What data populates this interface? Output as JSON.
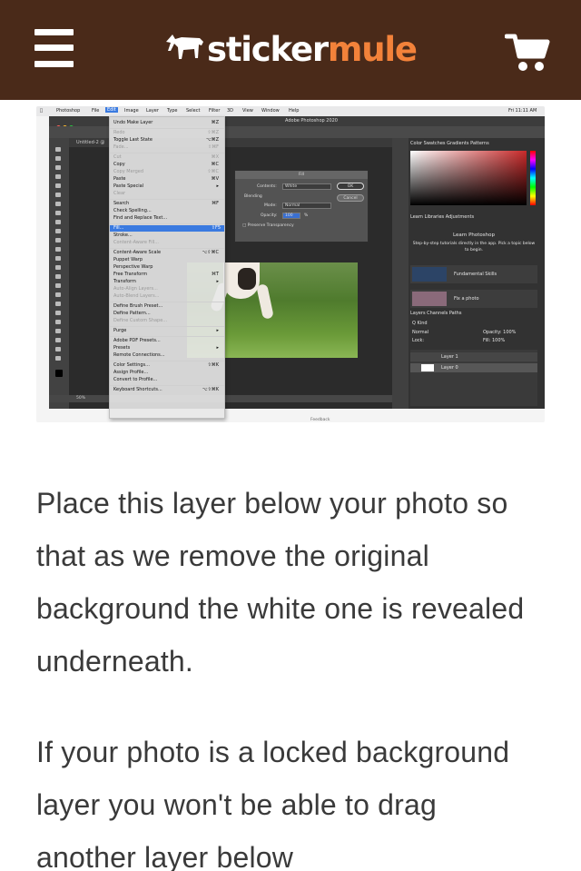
{
  "header": {
    "menu_icon": "hamburger-menu-icon",
    "logo_word_1": "sticker",
    "logo_word_2": "mule",
    "logo_icon": "mule-icon",
    "cart_icon": "shopping-cart-icon",
    "colors": {
      "background": "#4a2a19",
      "logo_white": "#ffffff",
      "logo_orange": "#f3823a"
    }
  },
  "screenshot": {
    "menubar": [
      "Photoshop",
      "File",
      "Edit",
      "Image",
      "Layer",
      "Type",
      "Select",
      "Filter",
      "3D",
      "View",
      "Window",
      "Help"
    ],
    "clock": "Fri 11:11 AM",
    "window_title": "Adobe Photoshop 2020",
    "doc_tab": "Untitled-2 @",
    "zoom": "50%",
    "edit_menu": [
      {
        "label": "Undo Make Layer",
        "shortcut": "⌘Z"
      },
      {
        "label": "Redo",
        "shortcut": "⇧⌘Z",
        "dim": true
      },
      {
        "label": "Toggle Last State",
        "shortcut": "⌥⌘Z"
      },
      {
        "label": "Fade...",
        "shortcut": "⇧⌘F",
        "dim": true
      },
      {
        "label": "Cut",
        "shortcut": "⌘X",
        "dim": true
      },
      {
        "label": "Copy",
        "shortcut": "⌘C"
      },
      {
        "label": "Copy Merged",
        "shortcut": "⇧⌘C",
        "dim": true
      },
      {
        "label": "Paste",
        "shortcut": "⌘V"
      },
      {
        "label": "Paste Special",
        "shortcut": "▸"
      },
      {
        "label": "Clear",
        "shortcut": "",
        "dim": true
      },
      {
        "label": "Search",
        "shortcut": "⌘F"
      },
      {
        "label": "Check Spelling...",
        "shortcut": ""
      },
      {
        "label": "Find and Replace Text...",
        "shortcut": ""
      },
      {
        "label": "Fill...",
        "shortcut": "⇧F5",
        "highlight": true
      },
      {
        "label": "Stroke...",
        "shortcut": ""
      },
      {
        "label": "Content-Aware Fill...",
        "shortcut": "",
        "dim": true
      },
      {
        "label": "Content-Aware Scale",
        "shortcut": "⌥⇧⌘C"
      },
      {
        "label": "Puppet Warp",
        "shortcut": ""
      },
      {
        "label": "Perspective Warp",
        "shortcut": ""
      },
      {
        "label": "Free Transform",
        "shortcut": "⌘T"
      },
      {
        "label": "Transform",
        "shortcut": "▸"
      },
      {
        "label": "Auto-Align Layers...",
        "shortcut": "",
        "dim": true
      },
      {
        "label": "Auto-Blend Layers...",
        "shortcut": "",
        "dim": true
      },
      {
        "label": "Define Brush Preset...",
        "shortcut": ""
      },
      {
        "label": "Define Pattern...",
        "shortcut": ""
      },
      {
        "label": "Define Custom Shape...",
        "shortcut": "",
        "dim": true
      },
      {
        "label": "Purge",
        "shortcut": "▸"
      },
      {
        "label": "Adobe PDF Presets...",
        "shortcut": ""
      },
      {
        "label": "Presets",
        "shortcut": "▸"
      },
      {
        "label": "Remote Connections...",
        "shortcut": ""
      },
      {
        "label": "Color Settings...",
        "shortcut": "⇧⌘K"
      },
      {
        "label": "Assign Profile...",
        "shortcut": ""
      },
      {
        "label": "Convert to Profile...",
        "shortcut": ""
      },
      {
        "label": "Keyboard Shortcuts...",
        "shortcut": "⌥⇧⌘K"
      }
    ],
    "fill_dialog": {
      "title": "Fill",
      "contents_label": "Contents:",
      "contents_value": "White",
      "blending_label": "Blending",
      "mode_label": "Mode:",
      "mode_value": "Normal",
      "opacity_label": "Opacity:",
      "opacity_value": "100",
      "opacity_unit": "%",
      "preserve_label": "Preserve Transparency",
      "ok": "OK",
      "cancel": "Cancel"
    },
    "panels": {
      "color_tabs": "Color   Swatches   Gradients   Patterns",
      "learn_tabs": "Learn   Libraries   Adjustments",
      "learn_title": "Learn Photoshop",
      "learn_desc": "Step-by-step tutorials directly in the app. Pick a topic below to begin.",
      "card_1": "Fundamental Skills",
      "card_2": "Fix a photo",
      "layers_tabs": "Layers   Channels   Paths",
      "kind": "Q Kind",
      "blend": "Normal",
      "opacity": "Opacity: 100%",
      "lock": "Lock:",
      "fill": "Fill: 100%",
      "layer_1": "Layer 1",
      "layer_0": "Layer 0"
    },
    "feedback": "Feedback"
  },
  "content": {
    "paragraph_1": "Place this layer below your photo so that as we remove the original background the white one is revealed underneath.",
    "paragraph_2": "If your photo is a locked background layer you won't be able to drag another layer below"
  }
}
